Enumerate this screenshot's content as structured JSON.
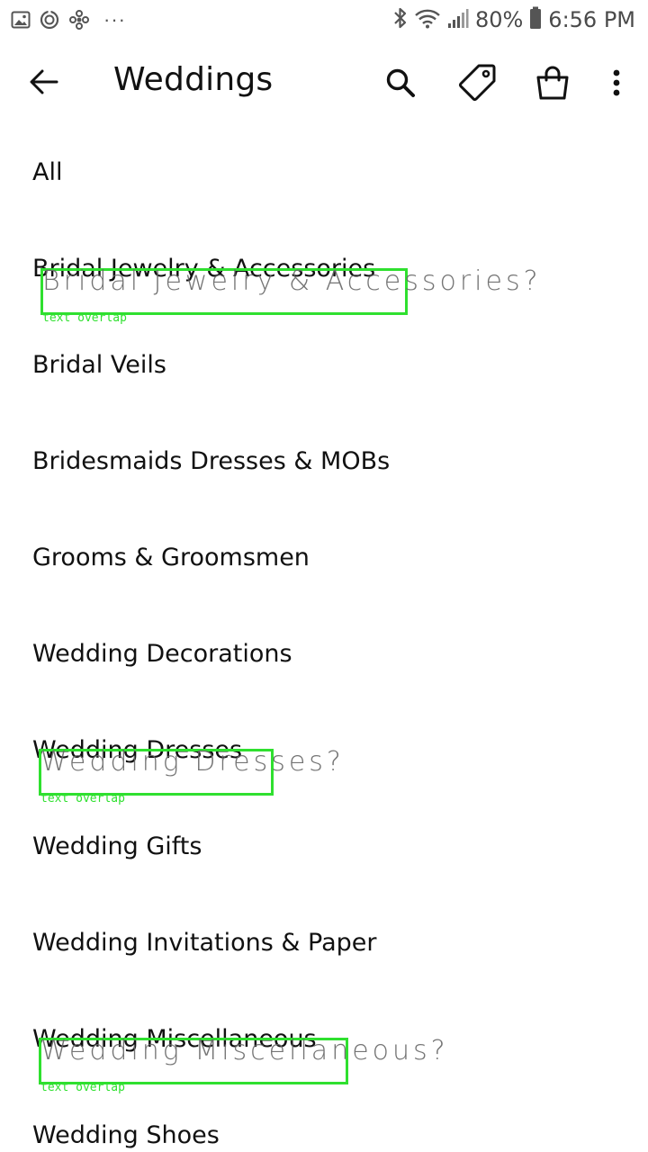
{
  "status_bar": {
    "battery": "80%",
    "time": "6:56 PM",
    "left_icons": [
      "gallery-icon",
      "sync-icon",
      "fan-icon",
      "more-notifications-icon"
    ],
    "right_icons": [
      "bluetooth-icon",
      "wifi-icon",
      "signal-icon",
      "battery-icon"
    ]
  },
  "app_bar": {
    "title": "Weddings",
    "actions": [
      "search-icon",
      "tag-icon",
      "shopping-bag-icon",
      "overflow-menu-icon"
    ]
  },
  "categories": [
    "All",
    "Bridal Jewelry & Accessories",
    "Bridal Veils",
    "Bridesmaids Dresses & MOBs",
    "Grooms & Groomsmen",
    "Wedding Decorations",
    "Wedding Dresses",
    "Wedding Gifts",
    "Wedding Invitations & Paper",
    "Wedding Miscellaneous",
    "Wedding Shoes"
  ],
  "overlays": [
    {
      "text": "Bridal Jewelry & Accessories?",
      "tag": "text overlap"
    },
    {
      "text": "Wedding Dresses?",
      "tag": "text overlap"
    },
    {
      "text": "Wedding Miscellaneous?",
      "tag": "text overlap"
    }
  ],
  "colors": {
    "overlay_accent": "#2fe02f",
    "text_primary": "#111111",
    "background": "#ffffff"
  }
}
